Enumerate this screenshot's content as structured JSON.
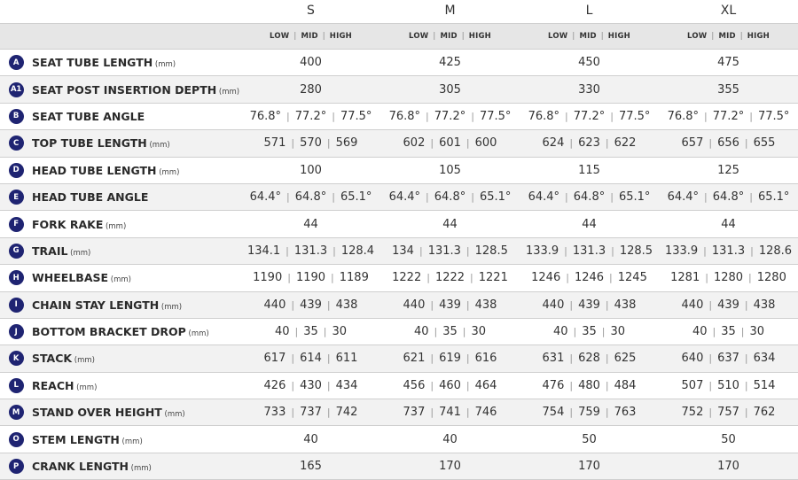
{
  "sizes": [
    "S",
    "M",
    "L",
    "XL"
  ],
  "sub_labels": [
    "LOW",
    "MID",
    "HIGH"
  ],
  "rows": [
    {
      "letter": "A",
      "name": "SEAT TUBE LENGTH",
      "unit": "(mm)",
      "values": [
        [
          "400"
        ],
        [
          "425"
        ],
        [
          "450"
        ],
        [
          "475"
        ]
      ]
    },
    {
      "letter": "A1",
      "name": "SEAT POST INSERTION DEPTH",
      "unit": "(mm)",
      "values": [
        [
          "280"
        ],
        [
          "305"
        ],
        [
          "330"
        ],
        [
          "355"
        ]
      ]
    },
    {
      "letter": "B",
      "name": "SEAT TUBE ANGLE",
      "unit": "",
      "values": [
        [
          "76.8°",
          "77.2°",
          "77.5°"
        ],
        [
          "76.8°",
          "77.2°",
          "77.5°"
        ],
        [
          "76.8°",
          "77.2°",
          "77.5°"
        ],
        [
          "76.8°",
          "77.2°",
          "77.5°"
        ]
      ]
    },
    {
      "letter": "C",
      "name": "TOP TUBE LENGTH",
      "unit": "(mm)",
      "values": [
        [
          "571",
          "570",
          "569"
        ],
        [
          "602",
          "601",
          "600"
        ],
        [
          "624",
          "623",
          "622"
        ],
        [
          "657",
          "656",
          "655"
        ]
      ]
    },
    {
      "letter": "D",
      "name": "HEAD TUBE LENGTH",
      "unit": "(mm)",
      "values": [
        [
          "100"
        ],
        [
          "105"
        ],
        [
          "115"
        ],
        [
          "125"
        ]
      ]
    },
    {
      "letter": "E",
      "name": "HEAD TUBE ANGLE",
      "unit": "",
      "values": [
        [
          "64.4°",
          "64.8°",
          "65.1°"
        ],
        [
          "64.4°",
          "64.8°",
          "65.1°"
        ],
        [
          "64.4°",
          "64.8°",
          "65.1°"
        ],
        [
          "64.4°",
          "64.8°",
          "65.1°"
        ]
      ]
    },
    {
      "letter": "F",
      "name": "FORK RAKE",
      "unit": "(mm)",
      "values": [
        [
          "44"
        ],
        [
          "44"
        ],
        [
          "44"
        ],
        [
          "44"
        ]
      ]
    },
    {
      "letter": "G",
      "name": "TRAIL",
      "unit": "(mm)",
      "values": [
        [
          "134.1",
          "131.3",
          "128.4"
        ],
        [
          "134",
          "131.3",
          "128.5"
        ],
        [
          "133.9",
          "131.3",
          "128.5"
        ],
        [
          "133.9",
          "131.3",
          "128.6"
        ]
      ]
    },
    {
      "letter": "H",
      "name": "WHEELBASE",
      "unit": "(mm)",
      "values": [
        [
          "1190",
          "1190",
          "1189"
        ],
        [
          "1222",
          "1222",
          "1221"
        ],
        [
          "1246",
          "1246",
          "1245"
        ],
        [
          "1281",
          "1280",
          "1280"
        ]
      ]
    },
    {
      "letter": "I",
      "name": "CHAIN STAY LENGTH",
      "unit": "(mm)",
      "values": [
        [
          "440",
          "439",
          "438"
        ],
        [
          "440",
          "439",
          "438"
        ],
        [
          "440",
          "439",
          "438"
        ],
        [
          "440",
          "439",
          "438"
        ]
      ]
    },
    {
      "letter": "J",
      "name": "BOTTOM BRACKET DROP",
      "unit": "(mm)",
      "values": [
        [
          "40",
          "35",
          "30"
        ],
        [
          "40",
          "35",
          "30"
        ],
        [
          "40",
          "35",
          "30"
        ],
        [
          "40",
          "35",
          "30"
        ]
      ]
    },
    {
      "letter": "K",
      "name": "STACK",
      "unit": "(mm)",
      "values": [
        [
          "617",
          "614",
          "611"
        ],
        [
          "621",
          "619",
          "616"
        ],
        [
          "631",
          "628",
          "625"
        ],
        [
          "640",
          "637",
          "634"
        ]
      ]
    },
    {
      "letter": "L",
      "name": "REACH",
      "unit": "(mm)",
      "values": [
        [
          "426",
          "430",
          "434"
        ],
        [
          "456",
          "460",
          "464"
        ],
        [
          "476",
          "480",
          "484"
        ],
        [
          "507",
          "510",
          "514"
        ]
      ]
    },
    {
      "letter": "M",
      "name": "STAND OVER HEIGHT",
      "unit": "(mm)",
      "values": [
        [
          "733",
          "737",
          "742"
        ],
        [
          "737",
          "741",
          "746"
        ],
        [
          "754",
          "759",
          "763"
        ],
        [
          "752",
          "757",
          "762"
        ]
      ]
    },
    {
      "letter": "O",
      "name": "STEM LENGTH",
      "unit": "(mm)",
      "values": [
        [
          "40"
        ],
        [
          "40"
        ],
        [
          "50"
        ],
        [
          "50"
        ]
      ]
    },
    {
      "letter": "P",
      "name": "CRANK LENGTH",
      "unit": "(mm)",
      "values": [
        [
          "165"
        ],
        [
          "170"
        ],
        [
          "170"
        ],
        [
          "170"
        ]
      ]
    }
  ],
  "colors": {
    "badge": "#1f2472",
    "header_bg": "#e6e6e6",
    "alt_row": "#f2f2f2"
  }
}
